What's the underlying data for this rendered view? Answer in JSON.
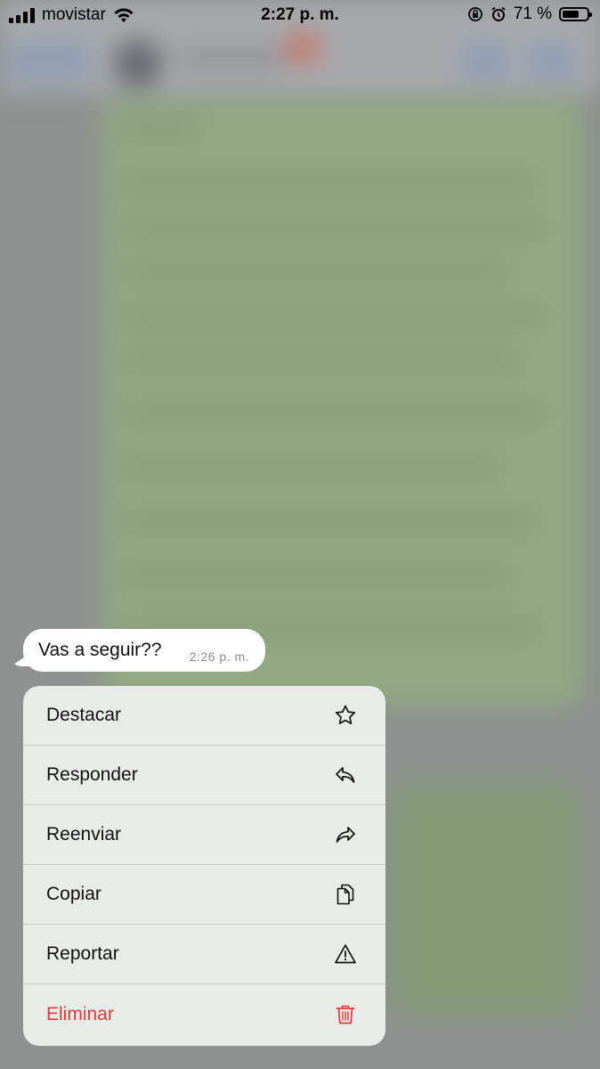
{
  "status_bar": {
    "carrier": "movistar",
    "time": "2:27 p. m.",
    "battery_percent": "71 %",
    "battery_level": 0.71
  },
  "message": {
    "text": "Vas a seguir??",
    "time": "2:26 p. m."
  },
  "context_menu": {
    "items": [
      {
        "label": "Destacar",
        "icon": "star-icon"
      },
      {
        "label": "Responder",
        "icon": "reply-icon"
      },
      {
        "label": "Reenviar",
        "icon": "forward-icon"
      },
      {
        "label": "Copiar",
        "icon": "copy-icon"
      },
      {
        "label": "Reportar",
        "icon": "warning-icon"
      },
      {
        "label": "Eliminar",
        "icon": "trash-icon"
      }
    ],
    "danger_color": "#e53935"
  }
}
